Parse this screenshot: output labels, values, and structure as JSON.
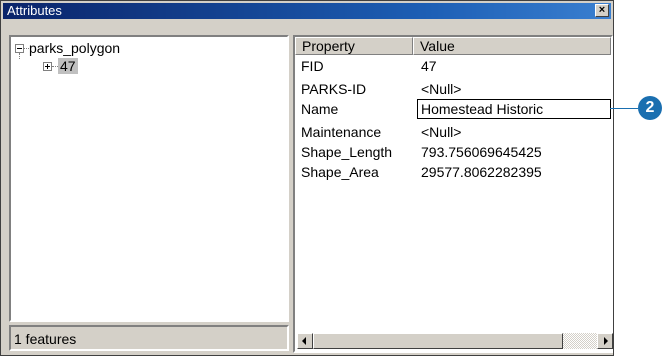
{
  "window": {
    "title": "Attributes",
    "close_glyph": "×"
  },
  "tree": {
    "root_label": "parks_polygon",
    "child_label": "47"
  },
  "status": {
    "text": "1 features"
  },
  "grid": {
    "headers": {
      "property": "Property",
      "value": "Value"
    },
    "rows": [
      {
        "property": "FID",
        "value": "47"
      },
      {
        "property": "PARKS-ID",
        "value": "<Null>"
      },
      {
        "property": "Name",
        "value": "Homestead Historic"
      },
      {
        "property": "Maintenance",
        "value": "<Null>"
      },
      {
        "property": "Shape_Length",
        "value": "793.756069645425"
      },
      {
        "property": "Shape_Area",
        "value": "29577.8062282395"
      }
    ],
    "editing_row": 2
  },
  "callout": {
    "number": "2",
    "color": "#1a6fb0"
  },
  "colors": {
    "titlebar": "#0a246a",
    "face": "#d4d0c8"
  }
}
